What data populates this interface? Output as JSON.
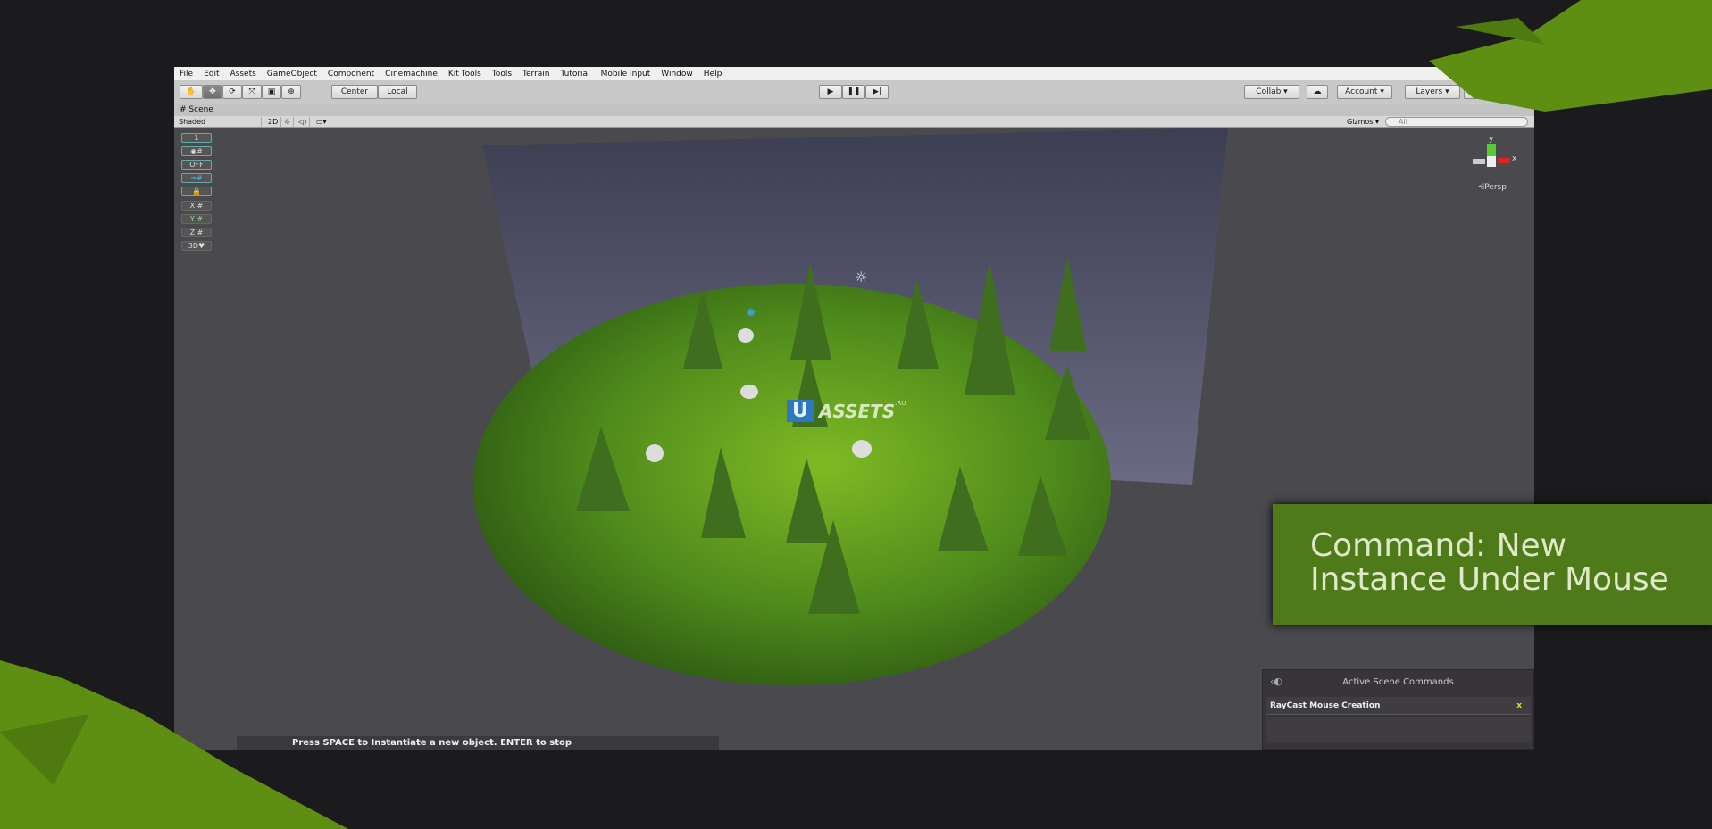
{
  "menu": [
    "File",
    "Edit",
    "Assets",
    "GameObject",
    "Component",
    "Cinemachine",
    "Kit Tools",
    "Tools",
    "Terrain",
    "Tutorial",
    "Mobile Input",
    "Window",
    "Help"
  ],
  "toolbar": {
    "center": "Center",
    "local": "Local",
    "collab": "Collab",
    "account": "Account",
    "layers": "Layers",
    "layout": "La"
  },
  "scene": {
    "tab": "Scene",
    "shading": "Shaded",
    "mode_2d": "2D",
    "gizmos": "Gizmos",
    "search_placeholder": "All",
    "persp": "Persp",
    "gizmo_y": "y",
    "gizmo_x": "x"
  },
  "side_buttons": [
    "1",
    "",
    "OFF",
    "",
    "",
    "X",
    "Y",
    "Z",
    "3D"
  ],
  "watermark": {
    "letter": "U",
    "text": "ASSETS",
    ".ru": ".RU"
  },
  "status_message": "Press SPACE to Instantiate a new object. ENTER to stop",
  "active_commands": {
    "title": "Active Scene Commands",
    "items": [
      {
        "label": "RayCast Mouse Creation",
        "close": "x"
      }
    ]
  },
  "banner": {
    "line1": "Command: New",
    "line2": "Instance Under Mouse"
  },
  "colors": {
    "banner": "#4e7a1a",
    "grass": "#4f8a1c",
    "leaf": "#5f8f12"
  }
}
